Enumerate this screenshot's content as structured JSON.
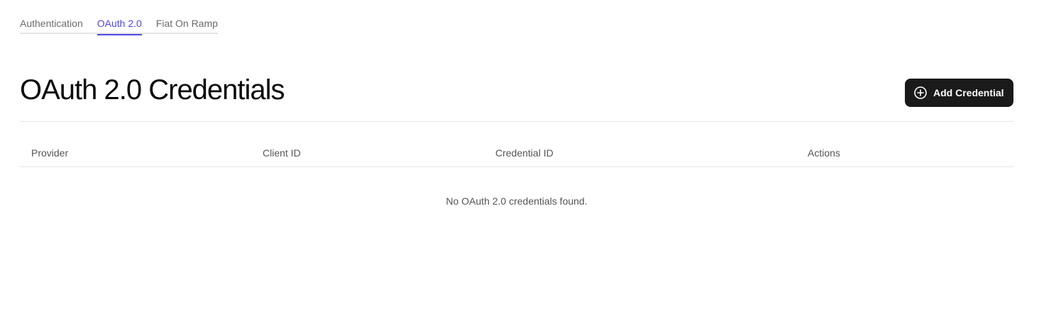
{
  "tabs": [
    {
      "label": "Authentication",
      "active": false
    },
    {
      "label": "OAuth 2.0",
      "active": true
    },
    {
      "label": "Fiat On Ramp",
      "active": false
    }
  ],
  "page": {
    "title": "OAuth 2.0 Credentials",
    "add_button_label": "Add Credential",
    "add_button_icon": "plus-circle-icon"
  },
  "table": {
    "columns": [
      "Provider",
      "Client ID",
      "Credential ID",
      "Actions"
    ],
    "rows": [],
    "empty_message": "No OAuth 2.0 credentials found."
  },
  "colors": {
    "accent": "#4f46e5",
    "button_bg": "#1a1a1a"
  }
}
